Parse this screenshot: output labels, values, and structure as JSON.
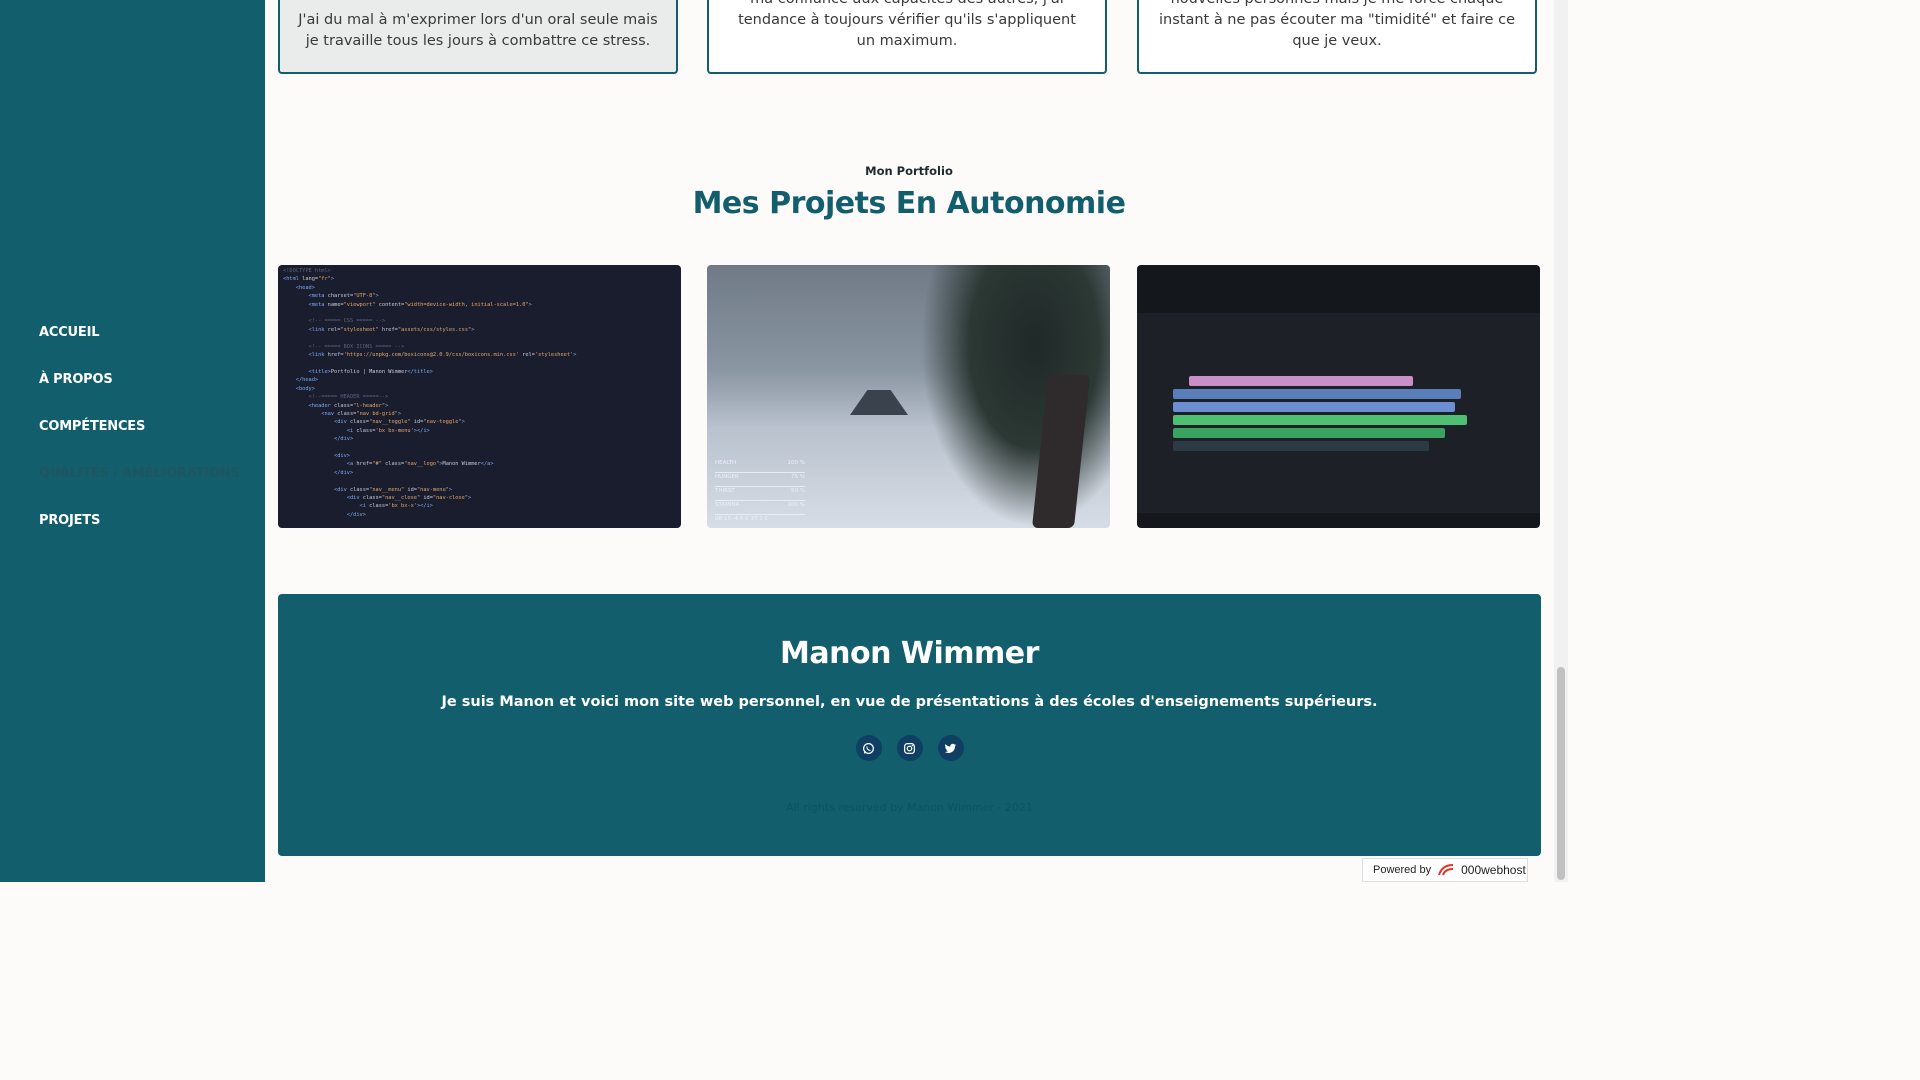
{
  "nav": {
    "items": [
      {
        "label": "ACCUEIL"
      },
      {
        "label": "À PROPOS"
      },
      {
        "label": "COMPÉTENCES"
      },
      {
        "label": "QUALITÉS / AMÉLIORATIONS"
      },
      {
        "label": "PROJETS"
      }
    ],
    "active_index": 3
  },
  "qualities": {
    "cards": [
      {
        "text": "J'ai du mal à m'exprimer lors d'un oral seule mais je travaille tous les jours à combattre ce stress."
      },
      {
        "text": "Lors de travaux en groupe, j'ai du mal à accorder ma confiance aux capacités des autres, j'ai tendance à toujours vérifier qu'ils s'appliquent un maximum."
      },
      {
        "text": "Je n'ai pas assez le réflexe de découvrir de nouvelles personnes mais je me force chaque instant à ne pas écouter ma \"timidité\" et faire ce que je veux."
      }
    ]
  },
  "portfolio": {
    "subtitle": "Mon Portfolio",
    "title": "Mes Projets En Autonomie",
    "game_hud": {
      "stats": [
        {
          "name": "HEALTH",
          "value": "100 %"
        },
        {
          "name": "HUNGER",
          "value": "75 %"
        },
        {
          "name": "THIRST",
          "value": "50 %"
        },
        {
          "name": "STAMINA",
          "value": "100 %"
        }
      ],
      "bottom_line": "08:15   -4.5 C   37.1 C"
    }
  },
  "footer": {
    "name": "Manon Wimmer",
    "description": "Je suis Manon et voici mon site web personnel, en vue de présentations à des écoles d'enseignements supérieurs.",
    "socials": [
      "whatsapp-icon",
      "instagram-icon",
      "twitter-icon"
    ],
    "copyright": "All rights reserved by Manon Wimmer - 2021"
  },
  "badge": {
    "prefix": "Powered by",
    "brand": "000webhost"
  },
  "colors": {
    "primary": "#135e6c",
    "background": "#fdfafa",
    "active_nav": "#1f5560",
    "social_bg": "#0f3f63"
  }
}
